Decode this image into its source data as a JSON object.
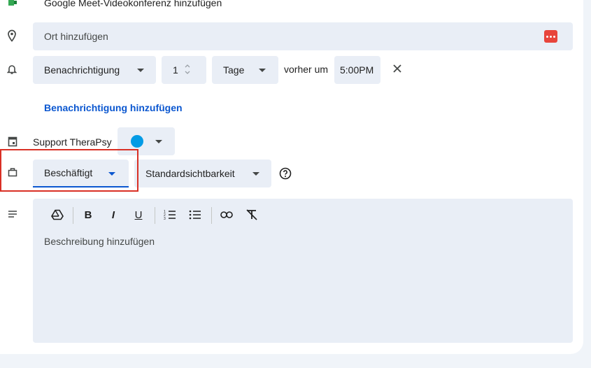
{
  "meet": {
    "label": "Google Meet-Videokonferenz hinzufügen"
  },
  "location": {
    "placeholder": "Ort hinzufügen"
  },
  "notification": {
    "type": "Benachrichtigung",
    "amount": "1",
    "unit": "Tage",
    "before_at": "vorher um",
    "time": "5:00PM",
    "add_link": "Benachrichtigung hinzufügen"
  },
  "calendar": {
    "name": "Support TheraPsy",
    "color": "#039be5"
  },
  "availability": {
    "status": "Beschäftigt",
    "visibility": "Standardsichtbarkeit"
  },
  "description": {
    "placeholder": "Beschreibung hinzufügen"
  },
  "colors": {
    "accent": "#0b57d0",
    "field_bg": "#e9eef6",
    "highlight_box": "#d93025",
    "meet_green": "#34a853"
  },
  "icons": [
    "meet-icon",
    "location-icon",
    "bell-icon",
    "calendar-icon",
    "briefcase-icon",
    "description-icon",
    "drive-icon",
    "bold-icon",
    "italic-icon",
    "underline-icon",
    "numbered-list-icon",
    "bulleted-list-icon",
    "link-icon",
    "clear-format-icon",
    "help-icon",
    "close-icon",
    "more-icon"
  ]
}
